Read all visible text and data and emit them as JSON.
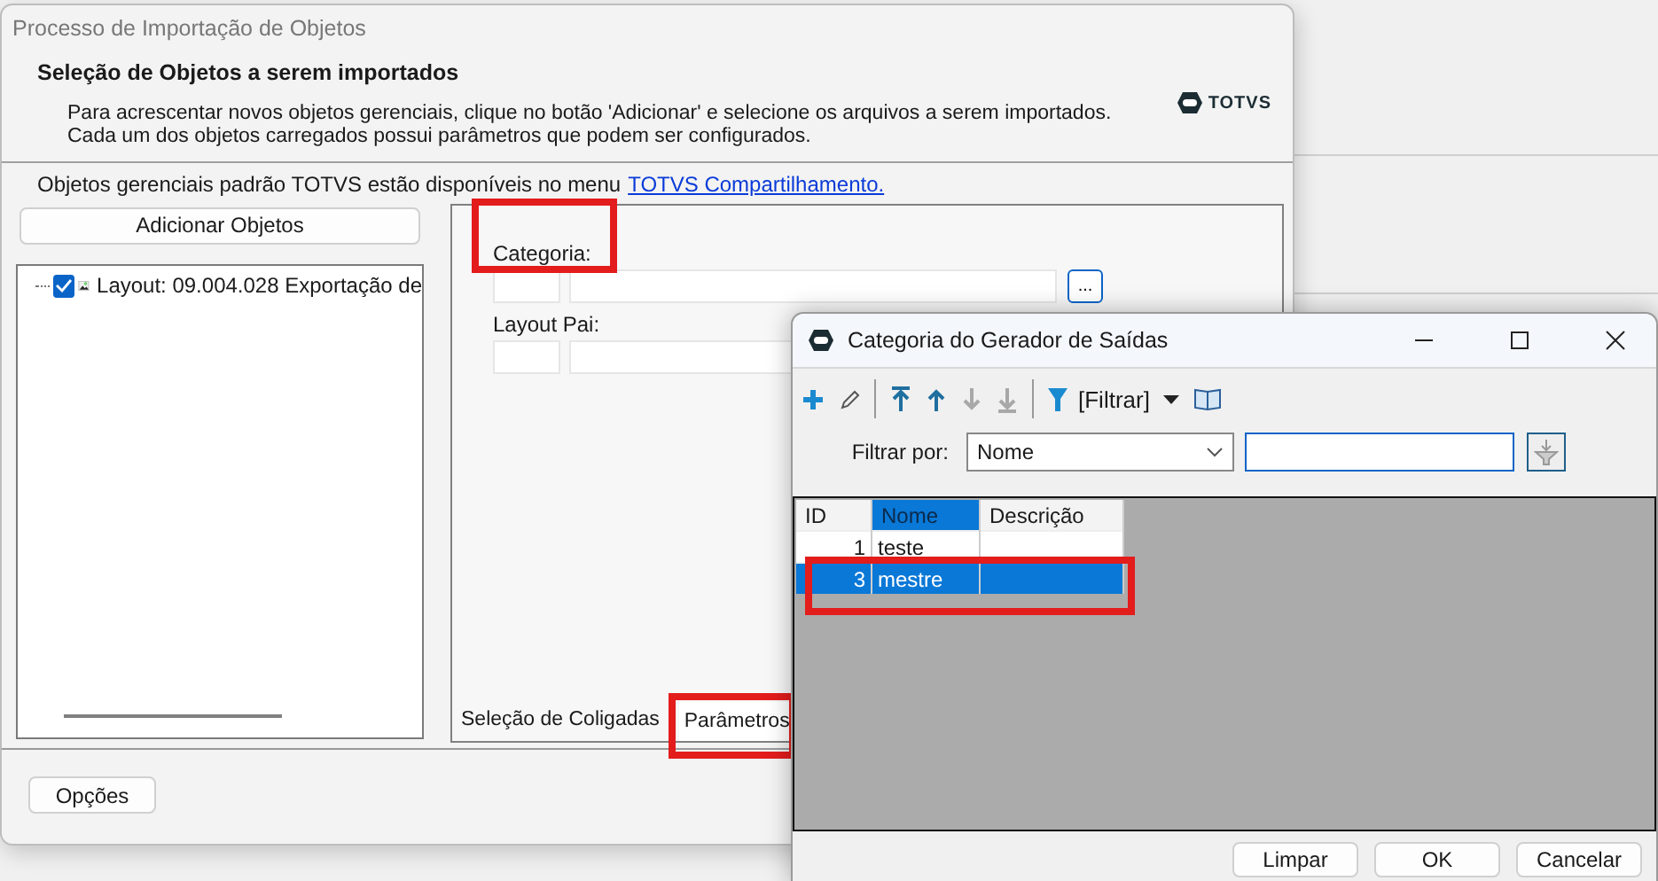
{
  "main_window": {
    "title": "Processo de Importação de Objetos",
    "heading": "Seleção de Objetos a serem importados",
    "description": [
      "Para acrescentar novos objetos gerenciais, clique no botão 'Adicionar' e selecione os arquivos a serem importados.",
      "Cada um dos objetos carregados possui parâmetros que podem ser configurados."
    ],
    "logo_text": "TOTVS",
    "info_text": "Objetos gerenciais padrão TOTVS estão disponíveis no menu",
    "info_link": "TOTVS Compartilhamento.",
    "add_button": "Adicionar Objetos",
    "tree": [
      {
        "label": "Layout: 09.004.028 Exportação de",
        "checked": true
      }
    ],
    "fields": [
      {
        "label": "Categoria:",
        "highlighted": true,
        "lookup": "..."
      },
      {
        "label": "Layout Pai:",
        "highlighted": false
      }
    ],
    "tabs": [
      {
        "label": "Seleção de Coligadas",
        "selected": false,
        "highlighted": false
      },
      {
        "label": "Parâmetros",
        "selected": true,
        "highlighted": true
      }
    ],
    "options_button": "Opções"
  },
  "dialog": {
    "title": "Categoria do Gerador de Saídas",
    "toolbar": [
      {
        "kind": "add",
        "disabled": false
      },
      {
        "kind": "edit",
        "disabled": false
      },
      {
        "kind": "separator"
      },
      {
        "kind": "first",
        "disabled": false
      },
      {
        "kind": "up",
        "disabled": false
      },
      {
        "kind": "down",
        "disabled": true
      },
      {
        "kind": "last",
        "disabled": true
      },
      {
        "kind": "separator"
      },
      {
        "kind": "filter",
        "label": "[Filtrar]",
        "disabled": false
      },
      {
        "kind": "dropdown",
        "disabled": false
      },
      {
        "kind": "book",
        "disabled": false
      }
    ],
    "filter": {
      "label": "Filtrar por:",
      "field": "Nome"
    },
    "columns": [
      {
        "label": "ID",
        "selected": false
      },
      {
        "label": "Nome",
        "selected": true
      },
      {
        "label": "Descrição",
        "selected": false
      }
    ],
    "rows": [
      {
        "id": "1",
        "name": "teste",
        "selected": false,
        "highlighted": false
      },
      {
        "id": "3",
        "name": "mestre",
        "selected": true,
        "highlighted": true
      }
    ],
    "buttons": [
      "Limpar",
      "OK",
      "Cancelar"
    ]
  }
}
